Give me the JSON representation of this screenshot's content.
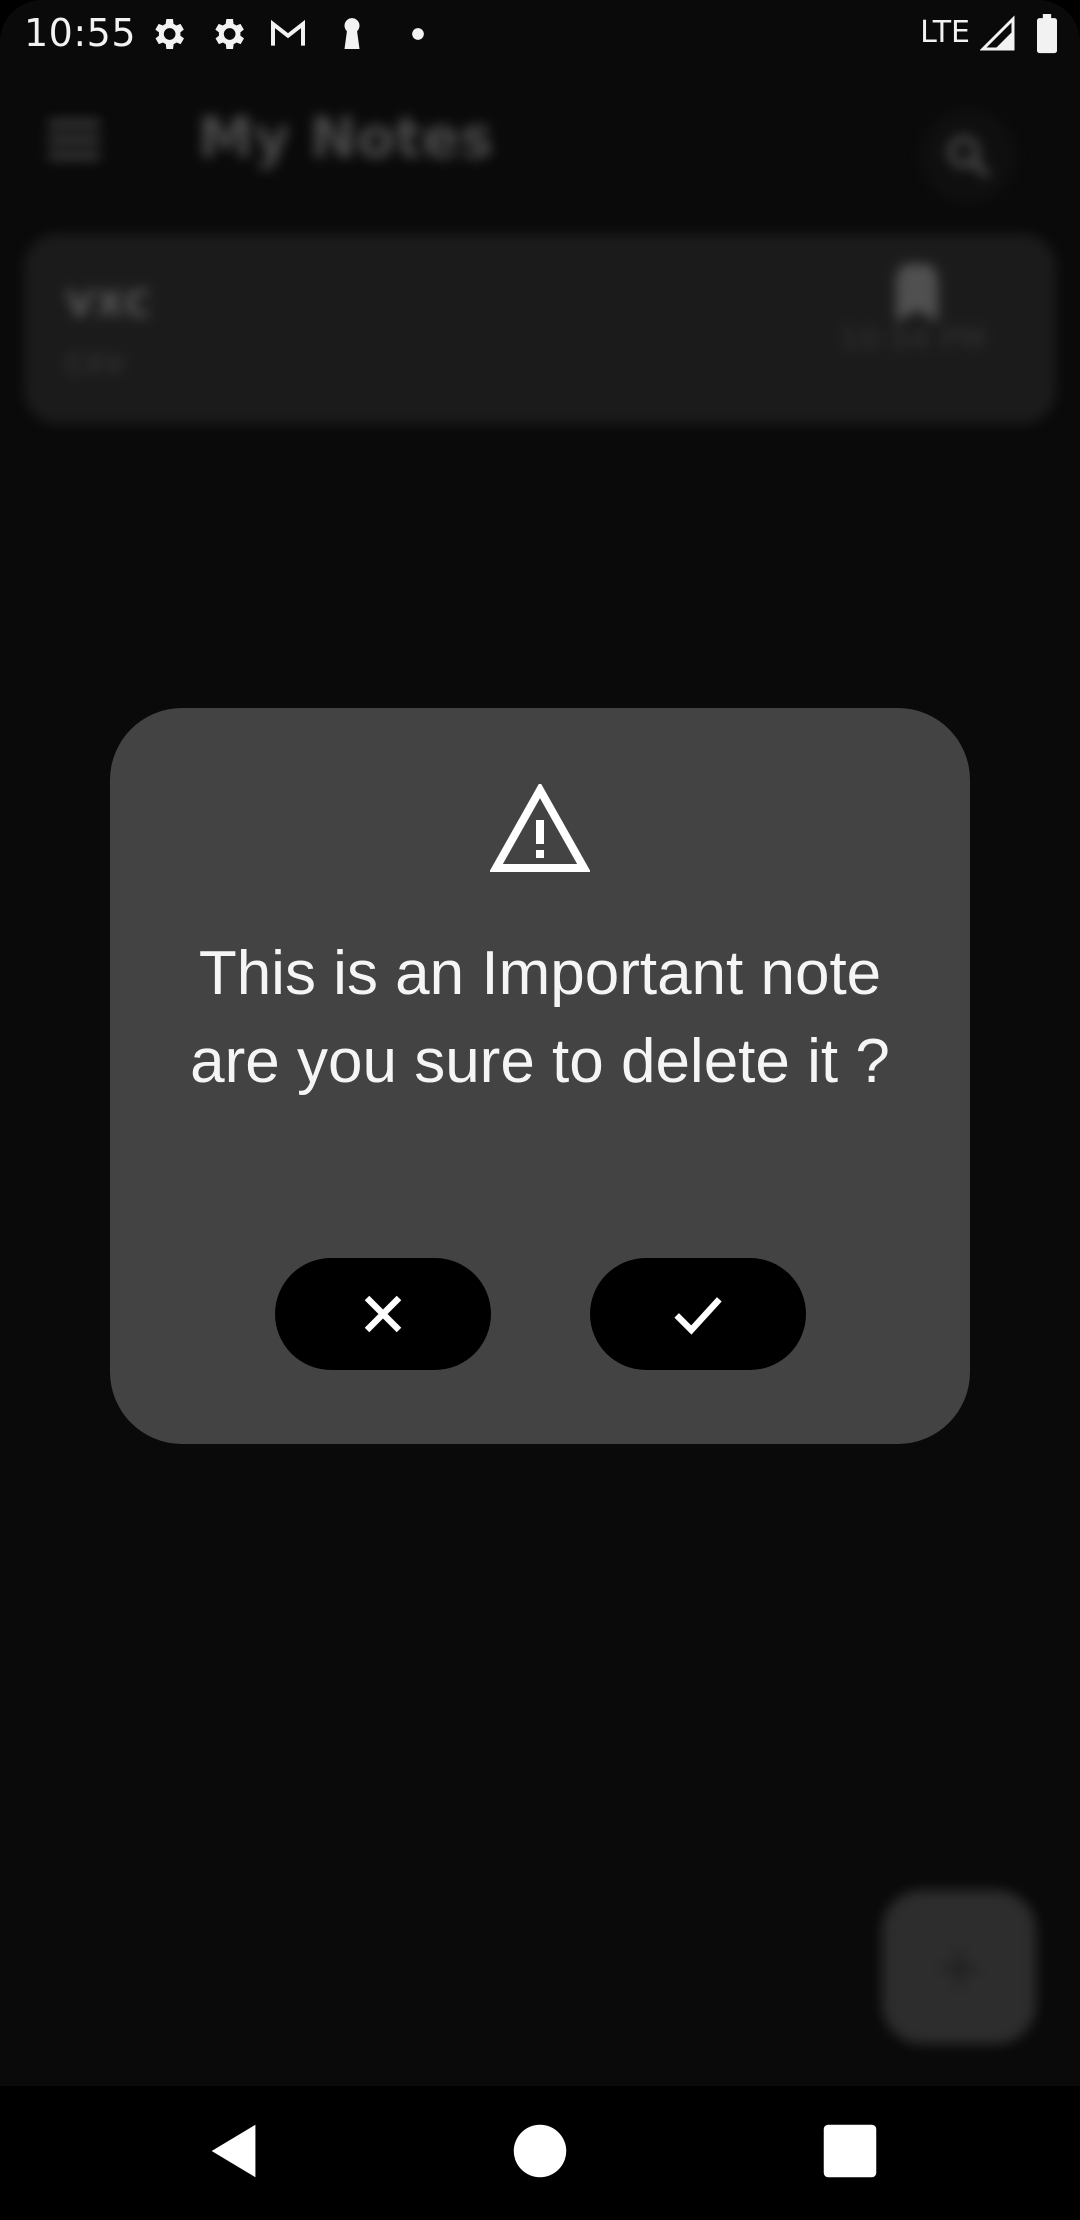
{
  "status_bar": {
    "time": "10:55",
    "network": "LTE",
    "icons": [
      "gear-icon",
      "gear-icon",
      "gmail-icon",
      "keyhole-icon",
      "dot-icon",
      "signal-icon",
      "battery-icon"
    ]
  },
  "app": {
    "title": "My Notes",
    "menu_icon": "menu-icon",
    "search_icon": "search-icon",
    "notes": [
      {
        "title": "VXC",
        "body": "CXV",
        "time": "10:54 PM",
        "pin_icon": "pin-icon"
      }
    ],
    "fab_label": "+"
  },
  "dialog": {
    "icon": "warning-icon",
    "message": "This is an Important note are you sure to delete it ?",
    "cancel_icon": "close-icon",
    "confirm_icon": "check-icon"
  },
  "nav_bar": {
    "icons": [
      "back-icon",
      "home-icon",
      "recents-icon"
    ]
  },
  "colors": {
    "background": "#0a0a0a",
    "dialog": "#434343",
    "button": "#000000",
    "text": "#f5f5f5"
  }
}
